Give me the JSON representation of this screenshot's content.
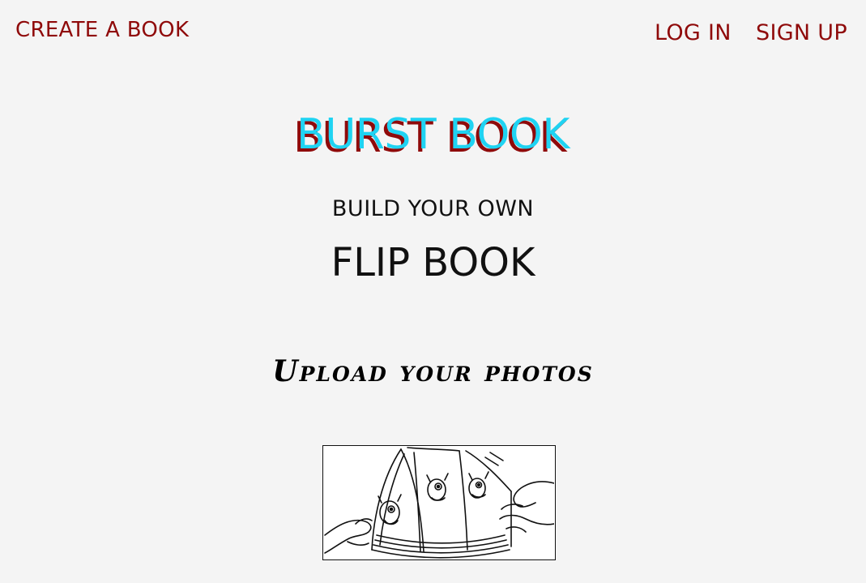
{
  "nav": {
    "create_label": "CREATE A BOOK",
    "login_label": "LOG IN",
    "signup_label": "SIGN UP"
  },
  "hero": {
    "title": "BURST BOOK",
    "tagline_line1": "BUILD YOUR OWN",
    "tagline_line2": "FLIP BOOK"
  },
  "upload": {
    "heading": "Upload your photos"
  },
  "colors": {
    "background": "#f4f4f4",
    "link": "#8f0a0a",
    "title_fill": "#1fd3f2",
    "title_shadow": "#8f0a0a",
    "text": "#111111"
  },
  "illustration": {
    "icon": "flip-book-illustration"
  }
}
